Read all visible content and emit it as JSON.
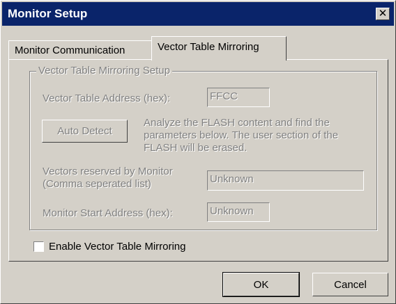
{
  "window": {
    "title": "Monitor Setup",
    "close_glyph": "✕"
  },
  "tabs": [
    {
      "label": "Monitor Communication",
      "active": false
    },
    {
      "label": "Vector Table Mirroring",
      "active": true
    }
  ],
  "group": {
    "legend": "Vector Table Mirroring Setup",
    "vector_table_address_label": "Vector Table Address (hex):",
    "vector_table_address_value": "FFCC",
    "auto_detect_label": "Auto Detect",
    "auto_detect_description": [
      "Analyze the FLASH content and find the",
      "parameters below. The user section of the",
      "FLASH will be erased."
    ],
    "vectors_reserved_label": [
      "Vectors reserved by Monitor",
      "(Comma seperated list)"
    ],
    "vectors_reserved_value": "Unknown",
    "monitor_start_label": "Monitor Start Address (hex):",
    "monitor_start_value": "Unknown"
  },
  "enable_mirroring": {
    "label": "Enable Vector Table Mirroring",
    "checked": false
  },
  "buttons": {
    "ok": "OK",
    "cancel": "Cancel"
  },
  "colors": {
    "titlebar": "#0a246a",
    "face": "#d4d0c8",
    "disabled_text": "#808080"
  }
}
